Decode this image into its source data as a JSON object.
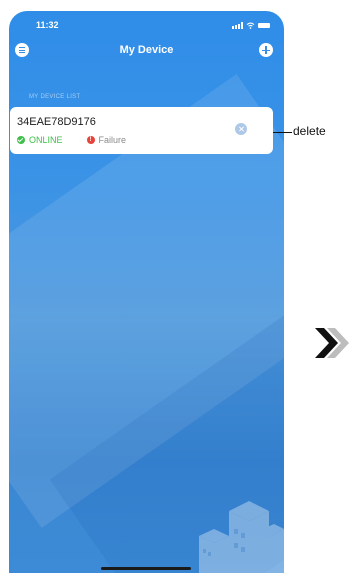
{
  "status_bar": {
    "time": "11:32",
    "icons": [
      "signal-icon",
      "wifi-icon",
      "battery-icon"
    ]
  },
  "header": {
    "title": "My Device",
    "left_icon": "menu-icon",
    "right_icon": "add-icon"
  },
  "device_list": {
    "section_label": "MY DEVICE LIST",
    "items": [
      {
        "device_id": "34EAE78D9176",
        "online_label": "ONLINE",
        "failure_label": "Failure",
        "delete_icon": "close-icon"
      }
    ]
  },
  "annotation": {
    "delete_label": "delete"
  },
  "colors": {
    "background_top": "#2f8de8",
    "background_bottom": "#3d8bd6",
    "online": "#3fbf4a",
    "failure": "#e8433a",
    "card": "#ffffff"
  }
}
